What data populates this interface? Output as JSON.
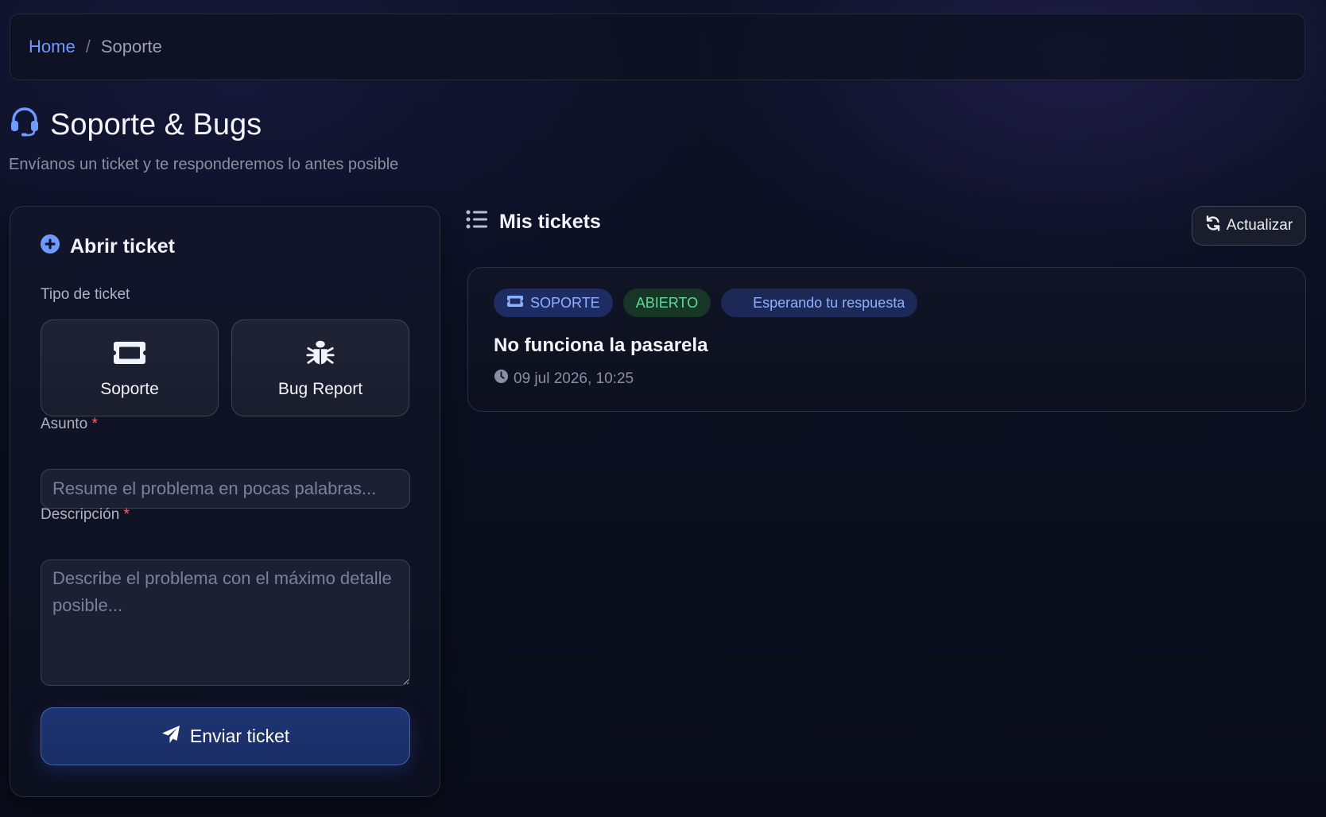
{
  "breadcrumb": {
    "home": "Home",
    "separator": "/",
    "current": "Soporte"
  },
  "header": {
    "title": "Soporte & Bugs",
    "subtitle": "Envíanos un ticket y te responderemos lo antes posible",
    "icon": "headset-icon"
  },
  "form": {
    "title": "Abrir ticket",
    "title_icon": "plus-circle-icon",
    "type_label": "Tipo de ticket",
    "types": [
      {
        "label": "Soporte",
        "icon": "ticket-icon"
      },
      {
        "label": "Bug Report",
        "icon": "bug-icon"
      }
    ],
    "subject_label": "Asunto",
    "subject_placeholder": "Resume el problema en pocas palabras...",
    "subject_value": "",
    "description_label": "Descripción",
    "description_placeholder": "Describe el problema con el máximo detalle posible...",
    "description_value": "",
    "required_mark": "*",
    "submit_label": "Enviar ticket",
    "submit_icon": "paper-plane-icon"
  },
  "tickets": {
    "title": "Mis tickets",
    "title_icon": "list-icon",
    "refresh_label": "Actualizar",
    "refresh_icon": "refresh-icon",
    "items": [
      {
        "type_badge": "SOPORTE",
        "status_badge": "ABIERTO",
        "waiting_badge": "Esperando tu respuesta",
        "title": "No funciona la pasarela",
        "date": "09 jul 2026, 10:25"
      }
    ]
  },
  "colors": {
    "accent": "#6e9bff",
    "required": "#ff5d6c",
    "status_open": "#62d99a",
    "primary_button": "#1e3574"
  }
}
